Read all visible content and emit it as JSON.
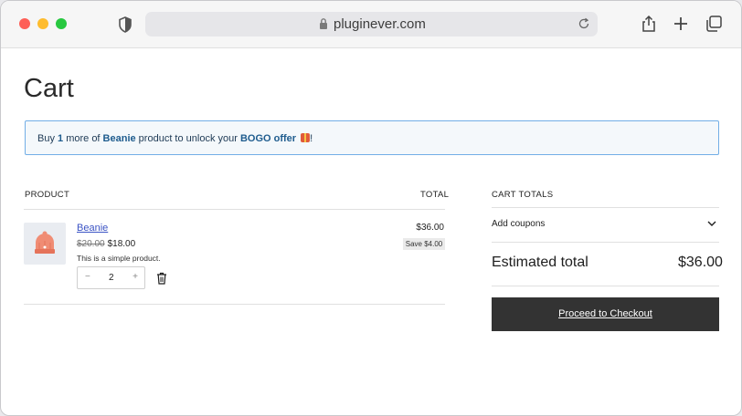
{
  "browser": {
    "url": "pluginever.com"
  },
  "page": {
    "title": "Cart",
    "notice": {
      "prefix": "Buy ",
      "count": "1",
      "middle": " more of ",
      "product": "Beanie",
      "suffix": " product to unlock your ",
      "offer": "BOGO offer",
      "end": "!"
    },
    "table": {
      "col_product": "PRODUCT",
      "col_total": "TOTAL"
    },
    "item": {
      "name": "Beanie",
      "regular_price": "$20.00",
      "sale_price": "$18.00",
      "description": "This is a simple product.",
      "quantity": "2",
      "minus": "−",
      "plus": "+",
      "total": "$36.00",
      "savings": "Save $4.00"
    },
    "totals": {
      "heading": "CART TOTALS",
      "coupons_label": "Add coupons",
      "estimated_label": "Estimated total",
      "estimated_value": "$36.00",
      "checkout_label": "Proceed to Checkout"
    }
  },
  "colors": {
    "accent_link": "#3b53c4",
    "notice_border": "#72aee6",
    "checkout_bg": "#333333"
  }
}
